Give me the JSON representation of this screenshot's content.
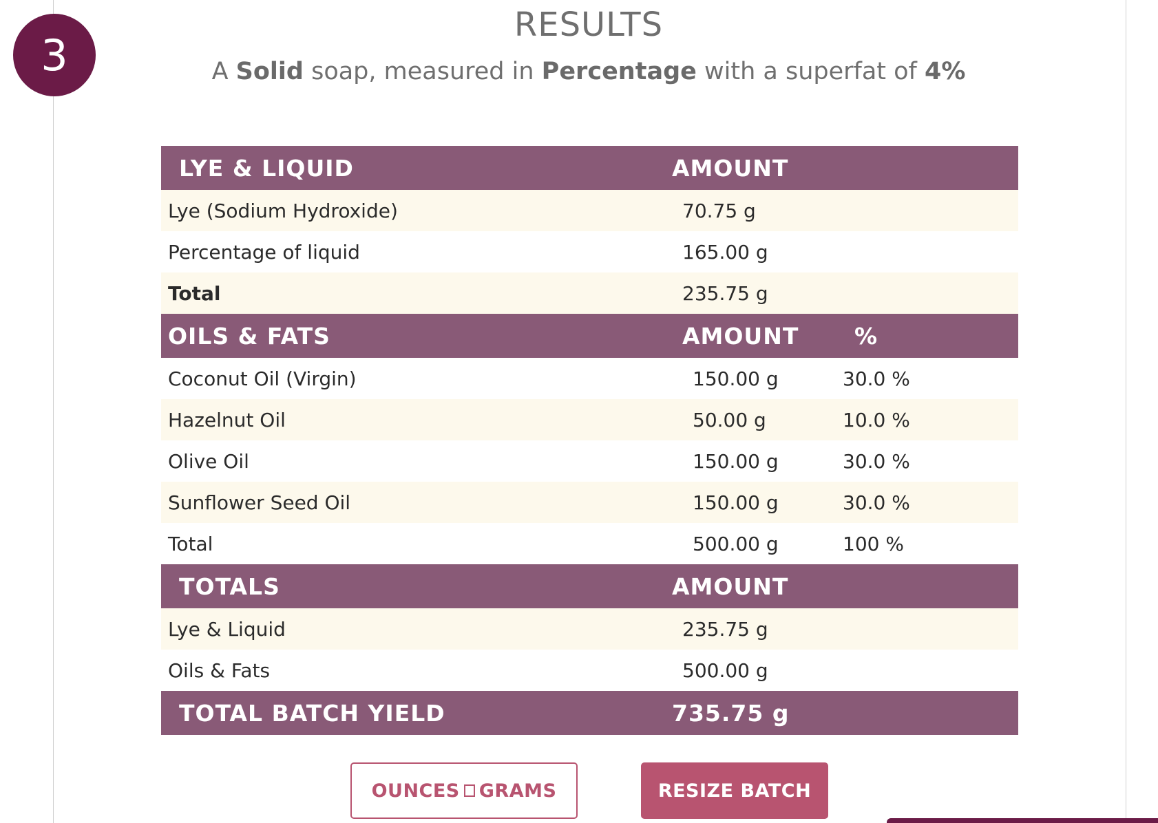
{
  "step": {
    "number": "3"
  },
  "results": {
    "title": "RESULTS",
    "subtitle": {
      "prefix": "A ",
      "soap_type": "Solid",
      "middle1": " soap, measured in ",
      "unit_mode": "Percentage",
      "middle2": " with a superfat of ",
      "superfat": "4%"
    }
  },
  "lye_liquid": {
    "header_name": "LYE & LIQUID",
    "header_amount": "AMOUNT",
    "rows": [
      {
        "name": "Lye (Sodium Hydroxide)",
        "amount": "70.75 g"
      },
      {
        "name": "Percentage of liquid",
        "amount": "165.00 g"
      }
    ],
    "total_label": "Total",
    "total_amount": "235.75 g"
  },
  "oils_fats": {
    "header_name": "OILS & FATS",
    "header_amount": "AMOUNT",
    "header_percent": "%",
    "rows": [
      {
        "name": "Coconut Oil (Virgin)",
        "amount": "150.00 g",
        "percent": "30.0 %"
      },
      {
        "name": "Hazelnut Oil",
        "amount": "50.00 g",
        "percent": "10.0 %"
      },
      {
        "name": "Olive Oil",
        "amount": "150.00 g",
        "percent": "30.0 %"
      },
      {
        "name": "Sunflower Seed Oil",
        "amount": "150.00 g",
        "percent": "30.0 %"
      }
    ],
    "total_label": "Total",
    "total_amount": "500.00 g",
    "total_percent": "100 %"
  },
  "totals": {
    "header_name": "TOTALS",
    "header_amount": "AMOUNT",
    "rows": [
      {
        "name": "Lye & Liquid",
        "amount": "235.75 g"
      },
      {
        "name": "Oils & Fats",
        "amount": "500.00 g"
      }
    ]
  },
  "batch_yield": {
    "label": "TOTAL BATCH YIELD",
    "amount": "735.75 g"
  },
  "buttons": {
    "toggle_left": "OUNCES",
    "toggle_right": "GRAMS",
    "resize": "RESIZE BATCH"
  },
  "colors": {
    "accent": "#6b1b47",
    "header_bg": "#895a77",
    "button": "#b85470",
    "alt_row": "#fdf9ec"
  }
}
